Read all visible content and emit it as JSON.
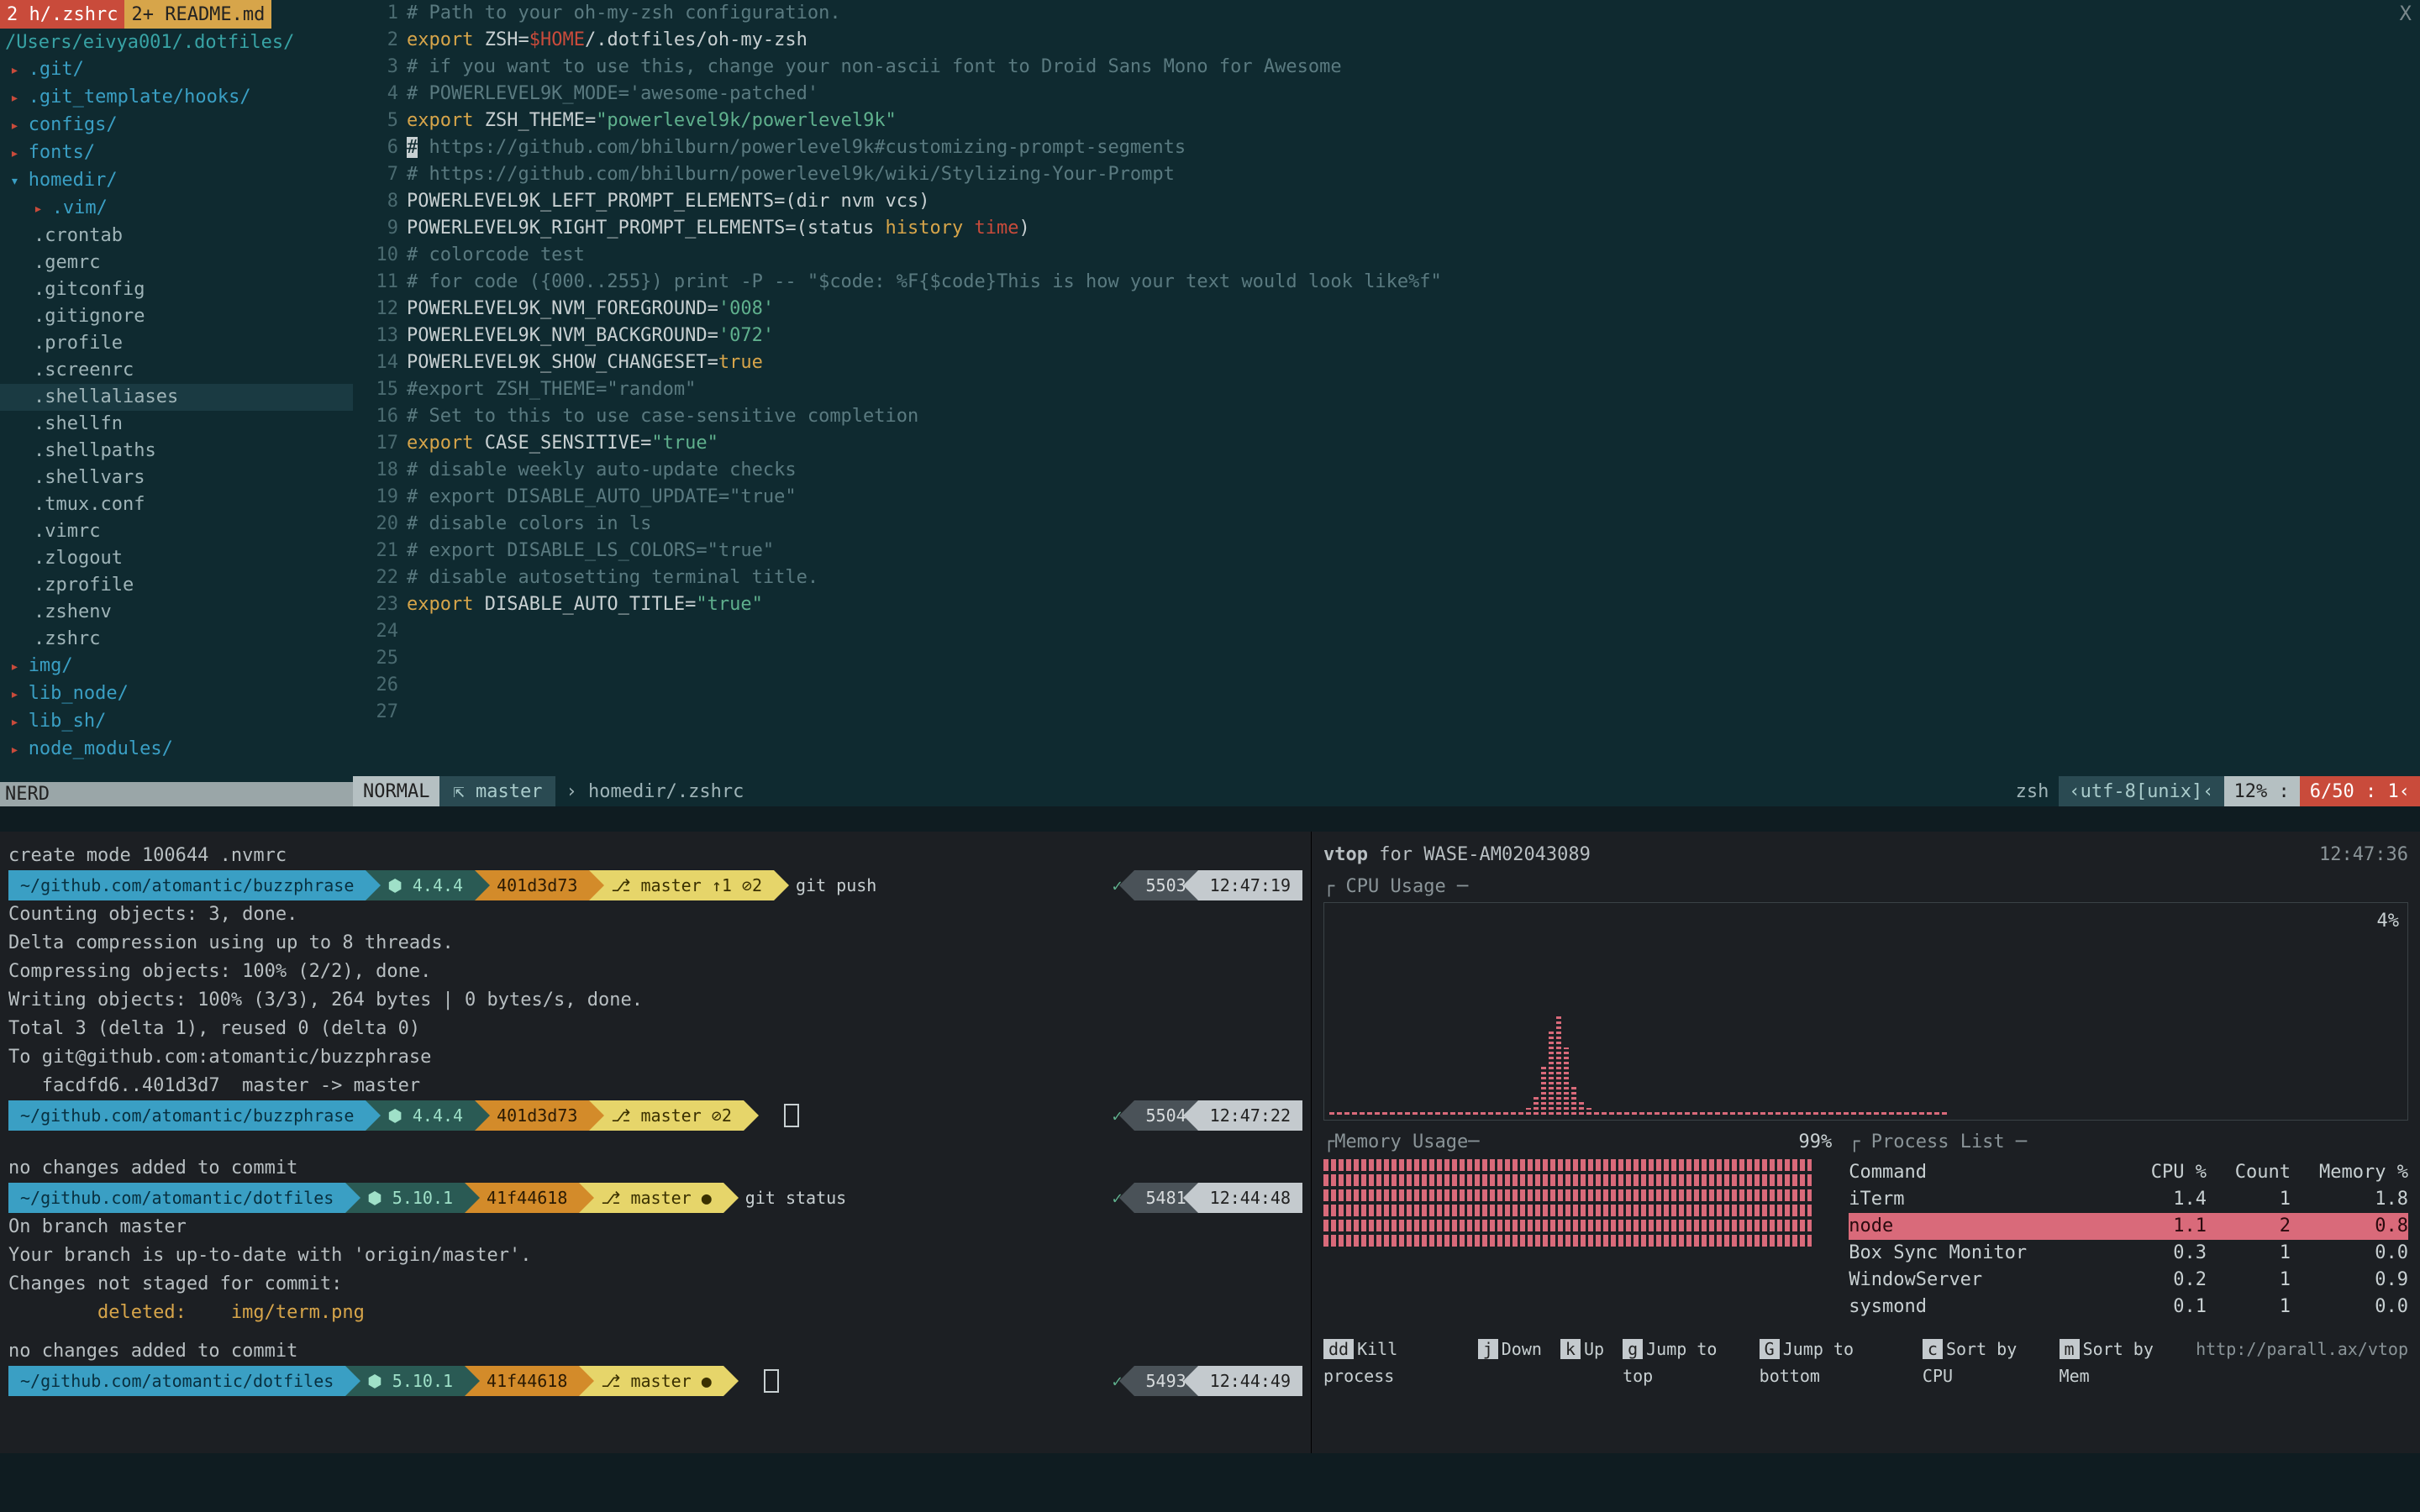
{
  "tabs": {
    "active_num": "2",
    "active": "h/.zshrc",
    "bg": "2+ README.md"
  },
  "close_x": "X",
  "sidebar": {
    "path": "/Users/eivya001/.dotfiles/",
    "items": [
      {
        "t": ".git/",
        "dir": true,
        "exp": "expand",
        "lvl": 0
      },
      {
        "t": ".git_template/hooks/",
        "dir": true,
        "exp": "expand",
        "lvl": 0
      },
      {
        "t": "configs/",
        "dir": true,
        "exp": "expand",
        "lvl": 0
      },
      {
        "t": "fonts/",
        "dir": true,
        "exp": "expand",
        "lvl": 0
      },
      {
        "t": "homedir/",
        "dir": true,
        "exp": "expanded",
        "lvl": 0
      },
      {
        "t": ".vim/",
        "dir": true,
        "exp": "expand",
        "lvl": 1
      },
      {
        "t": ".crontab",
        "dir": false,
        "lvl": 1
      },
      {
        "t": ".gemrc",
        "dir": false,
        "lvl": 1
      },
      {
        "t": ".gitconfig",
        "dir": false,
        "lvl": 1
      },
      {
        "t": ".gitignore",
        "dir": false,
        "lvl": 1
      },
      {
        "t": ".profile",
        "dir": false,
        "lvl": 1
      },
      {
        "t": ".screenrc",
        "dir": false,
        "lvl": 1
      },
      {
        "t": ".shellaliases",
        "dir": false,
        "lvl": 1,
        "hl": true
      },
      {
        "t": ".shellfn",
        "dir": false,
        "lvl": 1
      },
      {
        "t": ".shellpaths",
        "dir": false,
        "lvl": 1
      },
      {
        "t": ".shellvars",
        "dir": false,
        "lvl": 1
      },
      {
        "t": ".tmux.conf",
        "dir": false,
        "lvl": 1
      },
      {
        "t": ".vimrc",
        "dir": false,
        "lvl": 1
      },
      {
        "t": ".zlogout",
        "dir": false,
        "lvl": 1
      },
      {
        "t": ".zprofile",
        "dir": false,
        "lvl": 1
      },
      {
        "t": ".zshenv",
        "dir": false,
        "lvl": 1
      },
      {
        "t": ".zshrc",
        "dir": false,
        "lvl": 1
      },
      {
        "t": "img/",
        "dir": true,
        "exp": "expand",
        "lvl": 0
      },
      {
        "t": "lib_node/",
        "dir": true,
        "exp": "expand",
        "lvl": 0
      },
      {
        "t": "lib_sh/",
        "dir": true,
        "exp": "expand",
        "lvl": 0
      },
      {
        "t": "node_modules/",
        "dir": true,
        "exp": "expand",
        "lvl": 0
      }
    ],
    "footer": "NERD"
  },
  "code": [
    {
      "n": 1,
      "h": "<span class='tok-comment'># Path to your oh-my-zsh configuration.</span>"
    },
    {
      "n": 2,
      "h": "<span class='tok-kw'>export</span> <span class='tok-id'>ZSH=</span><span class='tok-var'>$HOME</span><span class='tok-id'>/.dotfiles/oh-my-zsh</span>"
    },
    {
      "n": 3,
      "h": "<span class='tok-comment'># if you want to use this, change your non-ascii font to Droid Sans Mono for Awesome</span>"
    },
    {
      "n": 4,
      "h": "<span class='tok-comment'># POWERLEVEL9K_MODE='awesome-patched'</span>"
    },
    {
      "n": 5,
      "h": "<span class='tok-kw'>export</span> <span class='tok-id'>ZSH_THEME=</span><span class='tok-str'>\"powerlevel9k/powerlevel9k\"</span>"
    },
    {
      "n": 6,
      "h": "<span style='background:#c8d0d2;color:#0f2a30'>#</span><span class='tok-comment'> https://github.com/bhilburn/powerlevel9k#customizing-prompt-segments</span>"
    },
    {
      "n": 7,
      "h": "<span class='tok-comment'># https://github.com/bhilburn/powerlevel9k/wiki/Stylizing-Your-Prompt</span>"
    },
    {
      "n": 8,
      "h": "<span class='tok-id'>POWERLEVEL9K_LEFT_PROMPT_ELEMENTS=(dir nvm vcs)</span>"
    },
    {
      "n": 9,
      "h": "<span class='tok-id'>POWERLEVEL9K_RIGHT_PROMPT_ELEMENTS=(status </span><span class='tok-hist'>history</span> <span class='tok-time'>time</span><span class='tok-id'>)</span>"
    },
    {
      "n": 10,
      "h": "<span class='tok-comment'># colorcode test</span>"
    },
    {
      "n": 11,
      "h": "<span class='tok-comment'># for code ({000..255}) print -P -- \"$code: %F{$code}This is how your text would look like%f\"</span>"
    },
    {
      "n": 12,
      "h": "<span class='tok-id'>POWERLEVEL9K_NVM_FOREGROUND=</span><span class='tok-str'>'008'</span>"
    },
    {
      "n": 13,
      "h": "<span class='tok-id'>POWERLEVEL9K_NVM_BACKGROUND=</span><span class='tok-str'>'072'</span>"
    },
    {
      "n": 14,
      "h": "<span class='tok-id'>POWERLEVEL9K_SHOW_CHANGESET=</span><span class='tok-kw'>true</span>"
    },
    {
      "n": 15,
      "h": "<span class='tok-comment'>#export ZSH_THEME=\"random\"</span>"
    },
    {
      "n": 16,
      "h": ""
    },
    {
      "n": 17,
      "h": "<span class='tok-comment'># Set to this to use case-sensitive completion</span>"
    },
    {
      "n": 18,
      "h": "<span class='tok-kw'>export</span> <span class='tok-id'>CASE_SENSITIVE=</span><span class='tok-str'>\"true\"</span>"
    },
    {
      "n": 19,
      "h": ""
    },
    {
      "n": 20,
      "h": "<span class='tok-comment'># disable weekly auto-update checks</span>"
    },
    {
      "n": 21,
      "h": "<span class='tok-comment'># export DISABLE_AUTO_UPDATE=\"true\"</span>"
    },
    {
      "n": 22,
      "h": ""
    },
    {
      "n": 23,
      "h": "<span class='tok-comment'># disable colors in ls</span>"
    },
    {
      "n": 24,
      "h": "<span class='tok-comment'># export DISABLE_LS_COLORS=\"true\"</span>"
    },
    {
      "n": 25,
      "h": ""
    },
    {
      "n": 26,
      "h": "<span class='tok-comment'># disable autosetting terminal title.</span>"
    },
    {
      "n": 27,
      "h": "<span class='tok-kw'>export</span> <span class='tok-id'>DISABLE_AUTO_TITLE=</span><span class='tok-str'>\"true\"</span>"
    }
  ],
  "status": {
    "mode": "NORMAL",
    "branch": "master",
    "file": "homedir/.zshrc",
    "ft": "zsh",
    "enc": "utf-8[unix]",
    "pct": "12% :",
    "pos": "6/50 :   1"
  },
  "terminals": {
    "a": {
      "pre": "create mode 100644 .nvmrc",
      "prompt": {
        "path": "~/github.com/atomantic/buzzphrase",
        "node": "⬢ 4.4.4",
        "hash": "401d3d73",
        "git": "⎇ master ↑1 ⊘2",
        "cmd": "git push",
        "ok": "✓",
        "num": "5503",
        "time": "12:47:19"
      },
      "out": "Counting objects: 3, done.\nDelta compression using up to 8 threads.\nCompressing objects: 100% (2/2), done.\nWriting objects: 100% (3/3), 264 bytes | 0 bytes/s, done.\nTotal 3 (delta 1), reused 0 (delta 0)\nTo git@github.com:atomantic/buzzphrase\n   facdfd6..401d3d7  master -> master",
      "prompt2": {
        "path": "~/github.com/atomantic/buzzphrase",
        "node": "⬢ 4.4.4",
        "hash": "401d3d73",
        "git": "⎇ master ⊘2",
        "cmd": "",
        "ok": "✓",
        "num": "5504",
        "time": "12:47:22"
      }
    },
    "b": {
      "pre": "no changes added to commit",
      "prompt": {
        "path": "~/github.com/atomantic/dotfiles",
        "node": "⬢ 5.10.1",
        "hash": "41f44618",
        "git": "⎇ master ●",
        "cmd": "git status",
        "ok": "✓",
        "num": "5481",
        "time": "12:44:48"
      },
      "out": "On branch master\nYour branch is up-to-date with 'origin/master'.\nChanges not staged for commit:\n        deleted:    img/term.png",
      "pre2": "no changes added to commit",
      "prompt2": {
        "path": "~/github.com/atomantic/dotfiles",
        "node": "⬢ 5.10.1",
        "hash": "41f44618",
        "git": "⎇ master ●",
        "cmd": "",
        "ok": "✓",
        "num": "5493",
        "time": "12:44:49"
      }
    }
  },
  "vtop": {
    "title": "vtop",
    "for": "for",
    "host": "WASE-AM02043089",
    "time": "12:47:36",
    "cpu_title": "CPU Usage",
    "cpu_pct": "4%",
    "cpu_bars": [
      2,
      2,
      3,
      2,
      2,
      3,
      2,
      3,
      2,
      2,
      2,
      2,
      3,
      2,
      2,
      2,
      3,
      2,
      2,
      3,
      2,
      2,
      3,
      2,
      0,
      0,
      4,
      12,
      30,
      50,
      60,
      40,
      18,
      8,
      4,
      3,
      2,
      3,
      2,
      2,
      3,
      2,
      2,
      2,
      2,
      3,
      2,
      2,
      3,
      2,
      2,
      3,
      2,
      2,
      2,
      2,
      3,
      2,
      2,
      3,
      2,
      2,
      3,
      2,
      2,
      2,
      3,
      2,
      2,
      3,
      2,
      2,
      3,
      2,
      2,
      3,
      2,
      2,
      2,
      2,
      3,
      2
    ],
    "mem_title": "Memory Usage",
    "mem_pct": "99%",
    "proc_title": "Process List",
    "proc_head": {
      "c1": "Command",
      "c2": "CPU %",
      "c3": "Count",
      "c4": "Memory %"
    },
    "procs": [
      {
        "cmd": "iTerm",
        "cpu": "1.4",
        "cnt": "1",
        "mem": "1.8"
      },
      {
        "cmd": "node",
        "cpu": "1.1",
        "cnt": "2",
        "mem": "0.8",
        "sel": true
      },
      {
        "cmd": "Box Sync Monitor",
        "cpu": "0.3",
        "cnt": "1",
        "mem": "0.0"
      },
      {
        "cmd": "WindowServer",
        "cpu": "0.2",
        "cnt": "1",
        "mem": "0.9"
      },
      {
        "cmd": "sysmond",
        "cpu": "0.1",
        "cnt": "1",
        "mem": "0.0"
      }
    ],
    "footer": [
      {
        "k": "dd",
        "t": "Kill process"
      },
      {
        "k": "j",
        "t": "Down"
      },
      {
        "k": "k",
        "t": "Up"
      },
      {
        "k": "g",
        "t": "Jump to top"
      },
      {
        "k": "G",
        "t": "Jump to bottom"
      },
      {
        "k": "c",
        "t": "Sort by CPU"
      },
      {
        "k": "m",
        "t": "Sort by Mem"
      }
    ],
    "url": "http://parall.ax/vtop"
  }
}
